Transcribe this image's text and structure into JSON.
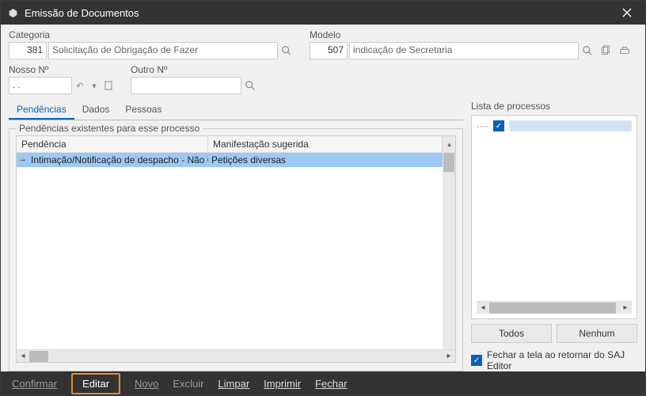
{
  "window": {
    "title": "Emissão de Documentos"
  },
  "categoria": {
    "label": "Categoria",
    "code": "381",
    "text": "Solicitação de Obrigação de Fazer"
  },
  "modelo": {
    "label": "Modelo",
    "code": "507",
    "text": "indicação de Secretaria"
  },
  "nosso": {
    "label": "Nosso Nº",
    "value": ". ."
  },
  "outro": {
    "label": "Outro Nº",
    "value": ""
  },
  "tabs": {
    "pendencias": "Pendências",
    "dados": "Dados",
    "pessoas": "Pessoas"
  },
  "fieldset": {
    "legend": "Pendências existentes para esse processo"
  },
  "grid": {
    "headers": {
      "pendencia": "Pendência",
      "manifestacao": "Manifestação sugerida"
    },
    "rows": [
      {
        "pendencia": "Intimação/Notificação de despacho - Não Cla",
        "manifestacao": "Petições diversas"
      }
    ]
  },
  "lista": {
    "label": "Lista de processos"
  },
  "buttons": {
    "todos": "Todos",
    "nenhum": "Nenhum"
  },
  "checkbox": {
    "label": "Fechar a tela ao retornar do SAJ Editor"
  },
  "footer": {
    "confirmar": "Confirmar",
    "editar": "Editar",
    "novo": "Novo",
    "excluir": "Excluir",
    "limpar": "Limpar",
    "imprimir": "Imprimir",
    "fechar": "Fechar"
  }
}
